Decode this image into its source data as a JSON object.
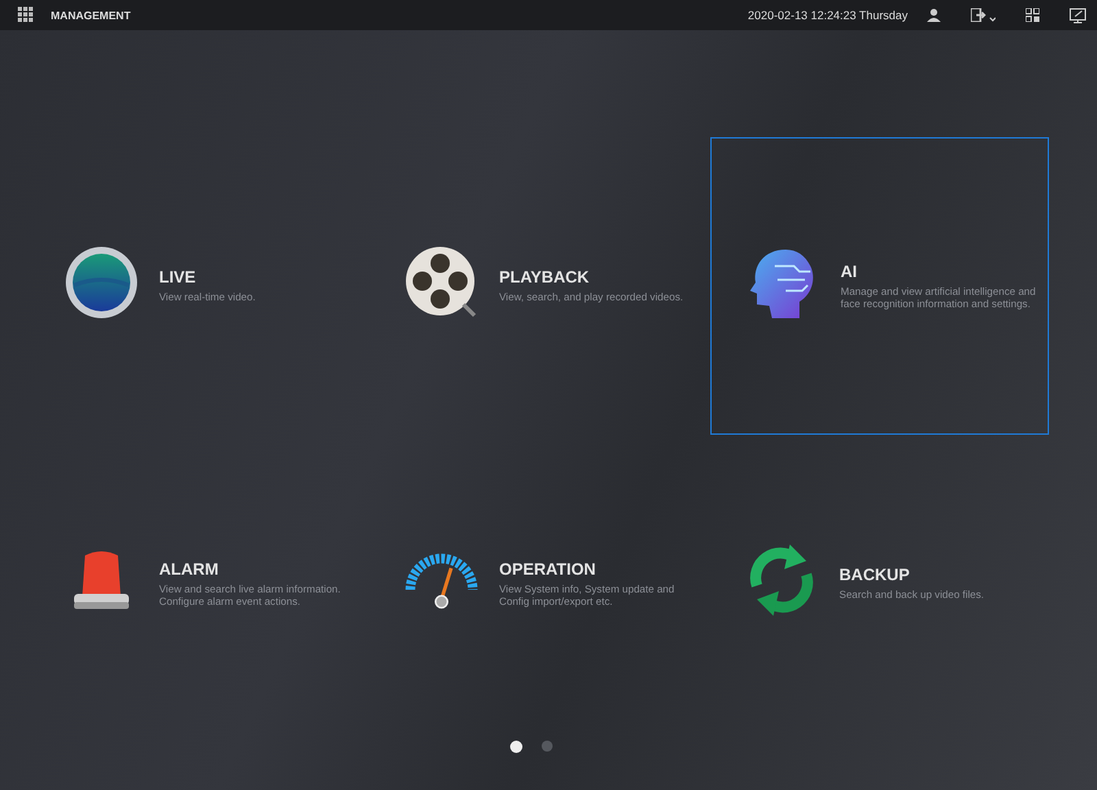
{
  "top_bar": {
    "title": "MANAGEMENT",
    "datetime": "2020-02-13 12:24:23 Thursday"
  },
  "tiles": [
    {
      "kind": "live",
      "title": "LIVE",
      "description": "View real-time video.",
      "selected": false
    },
    {
      "kind": "playback",
      "title": "PLAYBACK",
      "description": "View, search, and play recorded videos.",
      "selected": false
    },
    {
      "kind": "ai",
      "title": "AI",
      "description": "Manage and view artificial intelligence and\nface recognition information and settings.",
      "selected": true
    },
    {
      "kind": "alarm",
      "title": "ALARM",
      "description": "View and search live alarm information.\nConfigure alarm event actions.",
      "selected": false
    },
    {
      "kind": "operation",
      "title": "OPERATION",
      "description": "View System info, System update and\nConfig import/export etc.",
      "selected": false
    },
    {
      "kind": "backup",
      "title": "BACKUP",
      "description": "Search and back up video files.",
      "selected": false
    }
  ],
  "pages": [
    {
      "selected": true
    },
    {
      "selected": false
    }
  ]
}
